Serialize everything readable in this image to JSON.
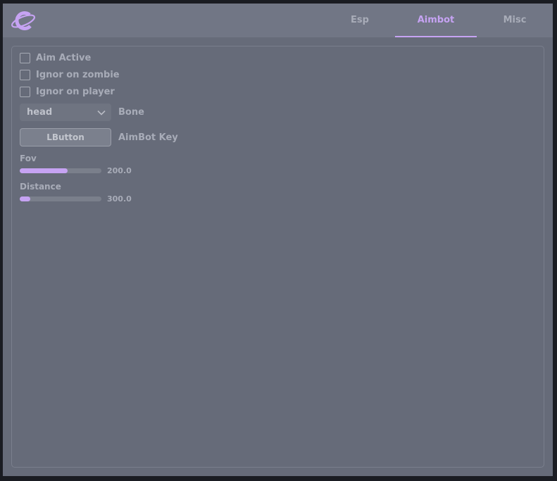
{
  "tabs": [
    {
      "label": "Esp",
      "active": false
    },
    {
      "label": "Aimbot",
      "active": true
    },
    {
      "label": "Misc",
      "active": false
    }
  ],
  "accent_color": "#c6a3f3",
  "logo_icon": "planet-logo-icon",
  "aimbot": {
    "checkboxes": [
      {
        "label": "Aim Active",
        "checked": false
      },
      {
        "label": "Ignor on zombie",
        "checked": false
      },
      {
        "label": "Ignor on player",
        "checked": false
      }
    ],
    "bone": {
      "value": "head",
      "label": "Bone"
    },
    "key": {
      "value": "LButton",
      "label": "AimBot Key"
    },
    "sliders": [
      {
        "label": "Fov",
        "value": "200.0",
        "fraction": 0.59
      },
      {
        "label": "Distance",
        "value": "300.0",
        "fraction": 0.13
      }
    ]
  }
}
